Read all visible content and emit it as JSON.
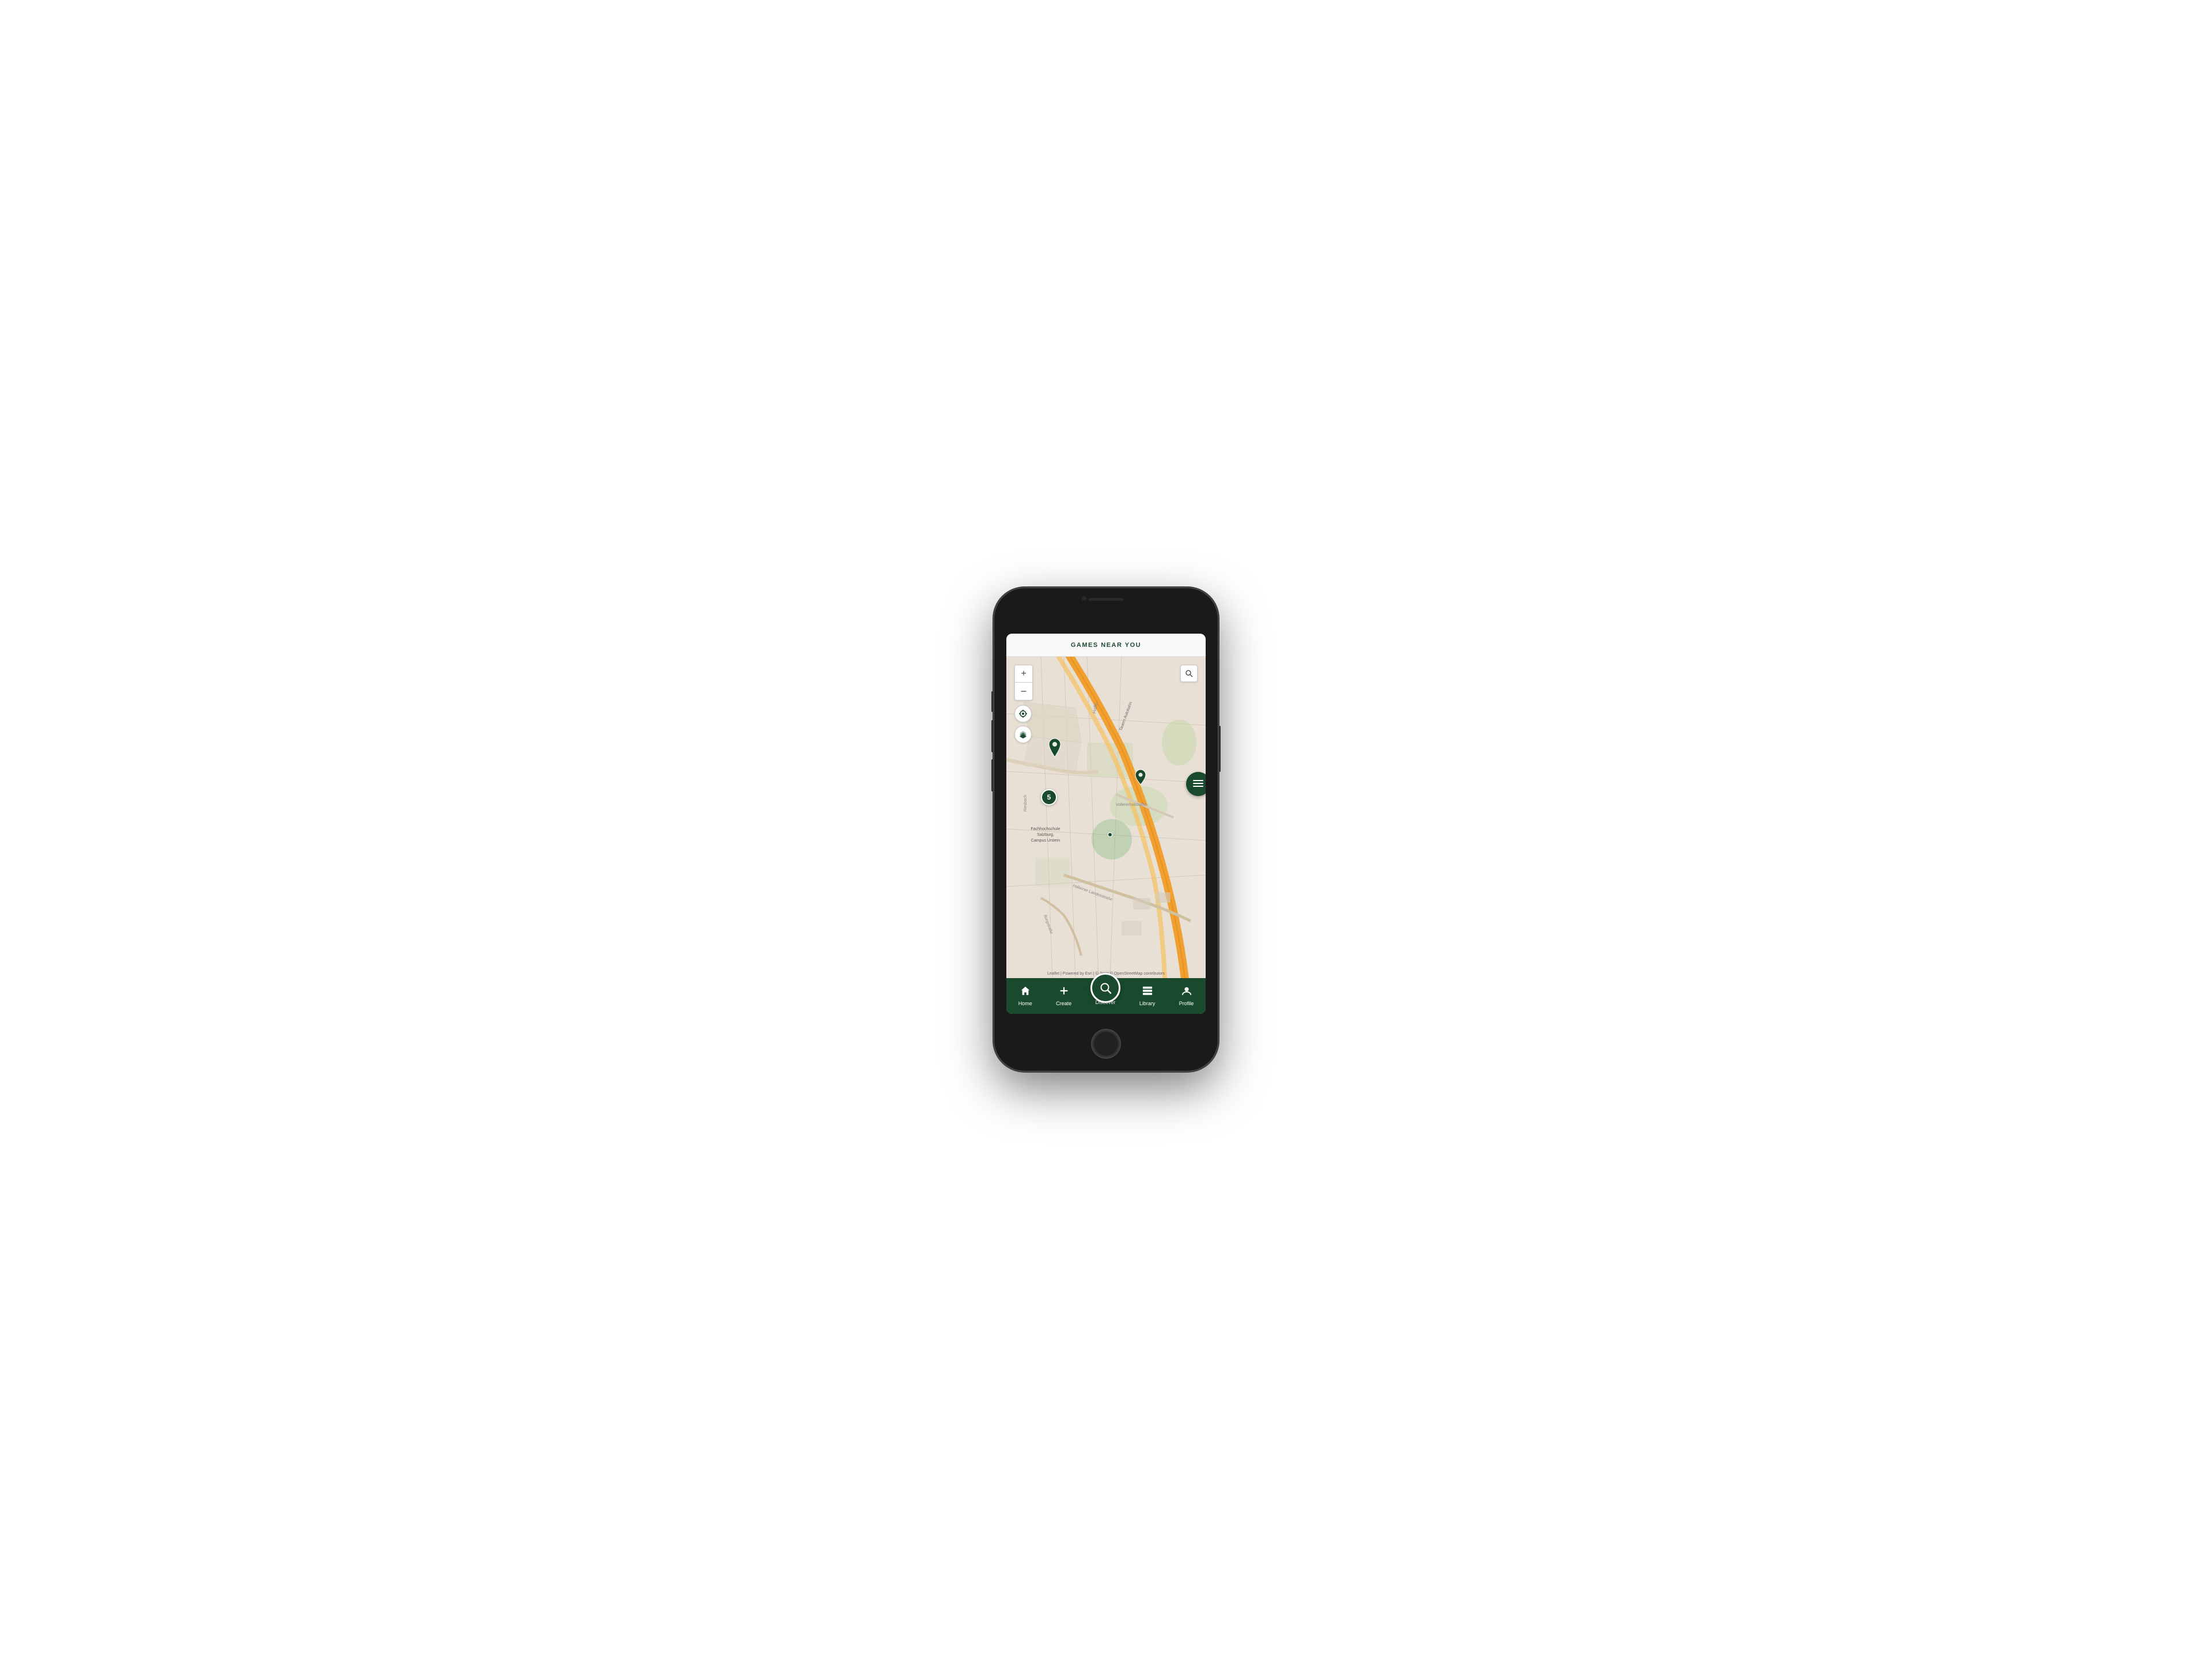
{
  "phone": {
    "screen_bg": "#f0ede8"
  },
  "header": {
    "title": "GAMES NEAR YOU"
  },
  "map": {
    "attribution": "Leaflet | Powered by Esri | © Jawg  © OpenStreetMap contributors",
    "controls": {
      "zoom_in": "+",
      "zoom_out": "−",
      "locate_label": "locate",
      "layers_label": "layers",
      "search_label": "search"
    },
    "labels": {
      "tauern_autobahn": "Tauern Autobahn",
      "vollererholstrasse": "Vollererholstraße",
      "halleiner_landesstrasse": "Halleiner Landesstraße",
      "riesbach": "Riesbach",
      "burgstrasse": "Burgstraße",
      "fachhochschule": "Fachhochschule\nSalzburg,\nCampus Urstein"
    },
    "cluster_count": "5",
    "list_button_label": "list"
  },
  "nav": {
    "items": [
      {
        "id": "home",
        "label": "Home",
        "icon": "⌂"
      },
      {
        "id": "create",
        "label": "Create",
        "icon": "+"
      },
      {
        "id": "discover",
        "label": "Discover",
        "icon": "🔍",
        "active": true,
        "fab": true
      },
      {
        "id": "library",
        "label": "Library",
        "icon": "▤"
      },
      {
        "id": "profile",
        "label": "Profile",
        "icon": "👤"
      }
    ]
  },
  "colors": {
    "brand_green": "#1a4a2e",
    "road_orange": "#f0a030",
    "map_bg": "#e8e0d5",
    "road_light": "#e8d5b0"
  }
}
